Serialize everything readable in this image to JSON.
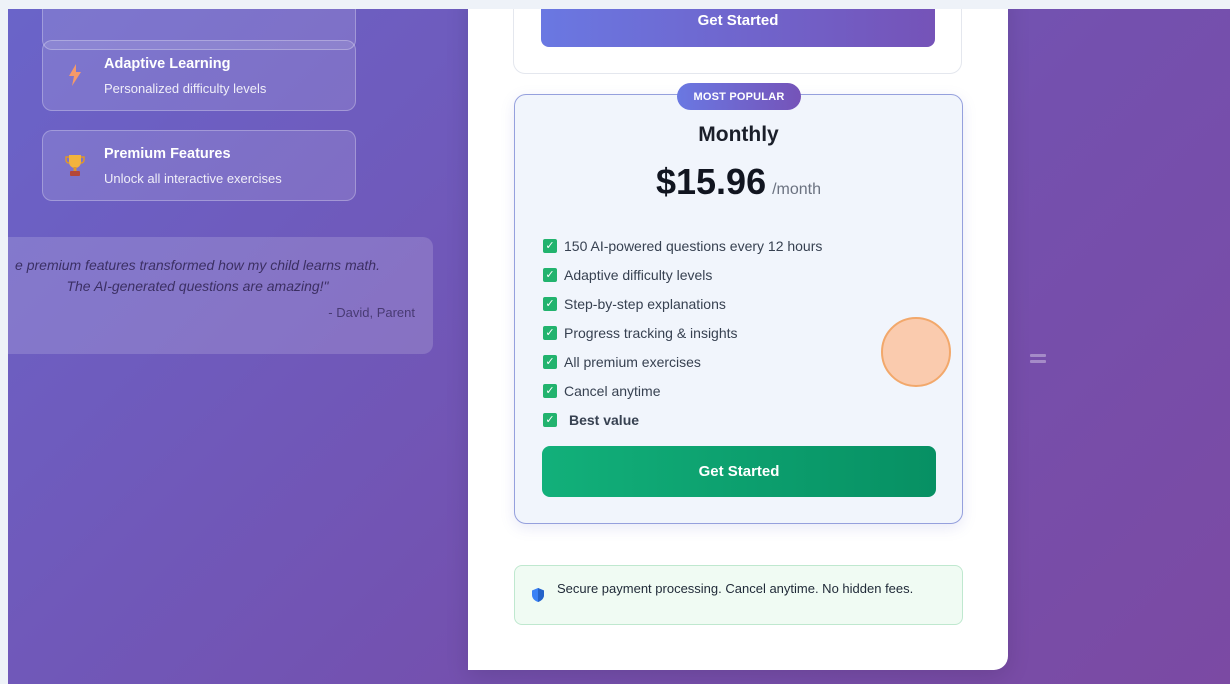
{
  "features": [
    {
      "title": "Adaptive Learning",
      "desc": "Personalized difficulty levels",
      "icon": "lightning-icon"
    },
    {
      "title": "Premium Features",
      "desc": "Unlock all interactive exercises",
      "icon": "trophy-icon"
    }
  ],
  "testimonial": {
    "line1": "e premium features transformed how my child learns math.",
    "line2": "The AI-generated questions are amazing!\"",
    "author": "- David, Parent"
  },
  "top_card": {
    "button": "Get Started"
  },
  "plan": {
    "badge": "MOST POPULAR",
    "name": "Monthly",
    "price": "$15.96",
    "period": "/month",
    "features": [
      "150 AI-powered questions every 12 hours",
      "Adaptive difficulty levels",
      "Step-by-step explanations",
      "Progress tracking & insights",
      "All premium exercises",
      "Cancel anytime",
      "Best value"
    ],
    "button": "Get Started"
  },
  "secure": {
    "text": "Secure payment processing. Cancel anytime. No hidden fees."
  },
  "colors": {
    "accent": "#6a78e2",
    "primary_green": "#12b07a",
    "check": "#22b36e"
  }
}
